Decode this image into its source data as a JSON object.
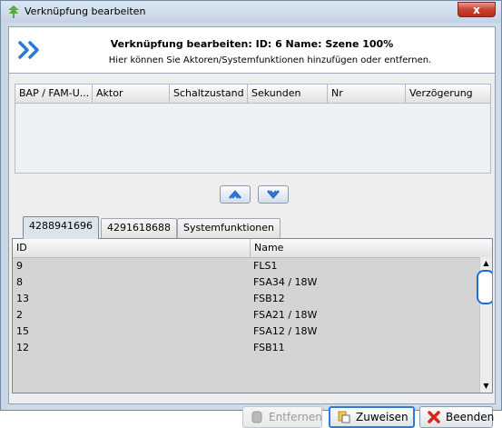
{
  "window": {
    "title": "Verknüpfung bearbeiten",
    "close_label": "x",
    "accent": "#2f7bd8"
  },
  "header": {
    "title": "Verknüpfung bearbeiten: ID: 6 Name: Szene 100%",
    "subtitle": "Hier können Sie Aktoren/Systemfunktionen hinzufügen oder entfernen."
  },
  "actions_table": {
    "columns": [
      "BAP / FAM-U...",
      "Aktor",
      "Schaltzustand",
      "Sekunden",
      "Nr",
      "Verzögerung"
    ],
    "rows": []
  },
  "move_buttons": {
    "up_icon": "chevron-double-up",
    "down_icon": "chevron-down"
  },
  "tabs": [
    {
      "label": "4288941696",
      "active": true
    },
    {
      "label": "4291618688",
      "active": false
    },
    {
      "label": "Systemfunktionen",
      "active": false
    }
  ],
  "device_table": {
    "columns": [
      "ID",
      "Name"
    ],
    "rows": [
      {
        "id": "9",
        "name": "FLS1"
      },
      {
        "id": "8",
        "name": "FSA34 / 18W"
      },
      {
        "id": "13",
        "name": "FSB12"
      },
      {
        "id": "2",
        "name": "FSA21 / 18W"
      },
      {
        "id": "15",
        "name": "FSA12 / 18W"
      },
      {
        "id": "12",
        "name": "FSB11"
      }
    ]
  },
  "buttons": {
    "remove": "Entfernen",
    "assign": "Zuweisen",
    "close": "Beenden"
  }
}
